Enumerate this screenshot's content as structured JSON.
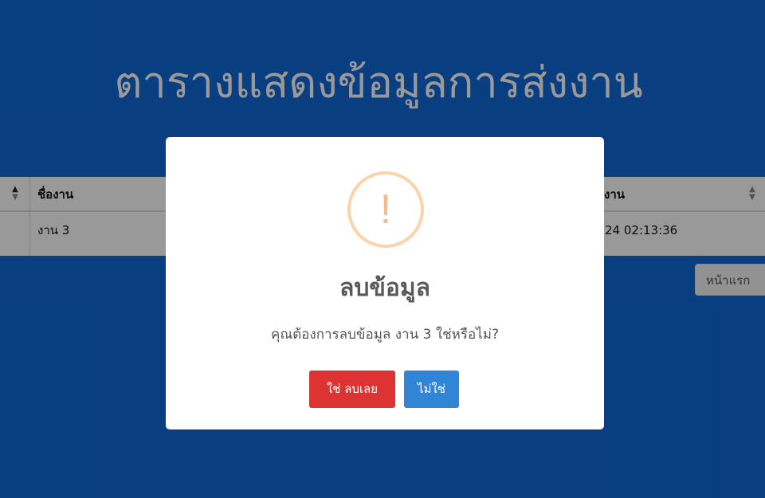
{
  "page": {
    "title": "ตารางแสดงข้อมูลการส่งงาน"
  },
  "table": {
    "headers": {
      "name": "ชื่องาน",
      "date_partial": "งาน"
    },
    "rows": [
      {
        "name": "งาน 3",
        "date_partial": "24 02:13:36"
      }
    ]
  },
  "pagination": {
    "first_label": "หน้าแรก"
  },
  "dialog": {
    "icon": "warning-icon",
    "icon_glyph": "!",
    "title": "ลบข้อมูล",
    "message": "คุณต้องการลบข้อมูล งาน 3 ใช่หรือไม่?",
    "confirm_label": "ใช่ ลบเลย",
    "cancel_label": "ไม่ใช่"
  },
  "colors": {
    "background": "#0f6ad8",
    "confirm": "#dd3333",
    "cancel": "#3085d6",
    "warning": "#f8bb86"
  }
}
